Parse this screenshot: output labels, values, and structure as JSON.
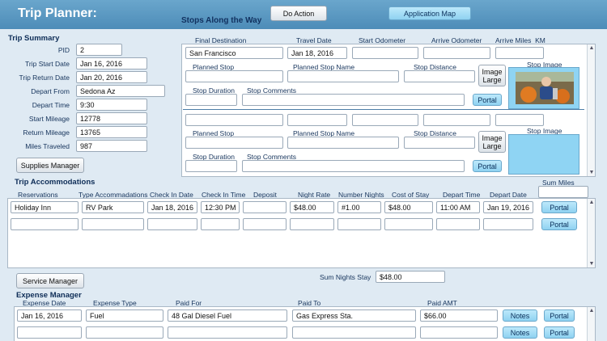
{
  "header": {
    "title": "Trip Planner:",
    "stops_title": "Stops Along the Way",
    "do_action": "Do Action",
    "app_map": "Application Map"
  },
  "summary": {
    "title": "Trip Summary",
    "pid_label": "PID",
    "pid": "2",
    "start_date_label": "Trip Start Date",
    "start_date": "Jan 16, 2016",
    "return_date_label": "Trip Return Date",
    "return_date": "Jan 20, 2016",
    "depart_from_label": "Depart From",
    "depart_from": "Sedona Az",
    "depart_time_label": "Depart Time",
    "depart_time": "9:30",
    "start_mileage_label": "Start Mileage",
    "start_mileage": "12778",
    "return_mileage_label": "Return Mileage",
    "return_mileage": "13765",
    "miles_traveled_label": "Miles Traveled",
    "miles_traveled": "987",
    "supplies_manager": "Supplies Manager"
  },
  "stops": {
    "col_final_destination": "Final Destination",
    "col_travel_date": "Travel Date",
    "col_start_odometer": "Start Odometer",
    "col_arrive_odometer": "Arrive Odometer",
    "col_arrive_miles": "Arrive Miles_KM",
    "planned_stop": "Planned Stop",
    "planned_stop_name": "Planned Stop Name",
    "stop_distance": "Stop Distance",
    "stop_image": "Stop Image",
    "image_large": "Image Large",
    "stop_duration": "Stop Duration",
    "stop_comments": "Stop Comments",
    "portal": "Portal",
    "row1": {
      "final_destination": "San Francisco",
      "travel_date": "Jan 18, 2016"
    }
  },
  "accommodations": {
    "title": "Trip Accommodations",
    "sum_miles_label": "Sum Miles",
    "headers": [
      "Reservations",
      "Type Accommadations",
      "Check In Date",
      "Check In Time",
      "Deposit",
      "Night Rate",
      "Number Nights",
      "Cost of Stay",
      "Depart Time",
      "Depart Date"
    ],
    "row1": [
      "Holiday Inn",
      "RV Park",
      "Jan 18, 2016",
      "12:30 PM",
      "",
      "$48.00",
      "#1.00",
      "$48.00",
      "11:00 AM",
      "Jan 19, 2016"
    ],
    "portal": "Portal",
    "sum_nights_label": "Sum Nights Stay",
    "sum_nights": "$48.00",
    "service_manager": "Service Manager"
  },
  "expenses": {
    "title": "Expense Manager",
    "headers": [
      "Expense Date",
      "Expense Type",
      "Paid For",
      "Paid To",
      "Paid AMT"
    ],
    "row1": [
      "Jan 16, 2016",
      "Fuel",
      "48 Gal Diesel Fuel",
      "Gas Express Sta.",
      "$66.00"
    ],
    "notes": "Notes",
    "portal": "Portal"
  }
}
